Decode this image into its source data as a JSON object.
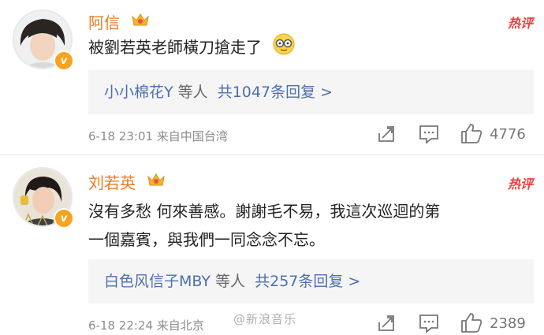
{
  "comments": [
    {
      "username": "阿信",
      "badge": "v",
      "hot_label": "热评",
      "text": "被劉若英老師橫刀搶走了",
      "reply": {
        "users": "小小棉花Y",
        "suffix": "等人",
        "count_text": "共1047条回复 >"
      },
      "meta": "6-18 23:01  来自中国台湾",
      "likes": "4776"
    },
    {
      "username": "刘若英",
      "badge": "v",
      "hot_label": "热评",
      "text_line1": "沒有多愁 何來善感。謝謝毛不易，我這次巡迴的第",
      "text_line2": "一個嘉賓，與我們一同念念不忘。",
      "reply": {
        "users": "白色风信子MBY",
        "suffix": "等人",
        "count_text": "共257条回复 >"
      },
      "meta": "6-18 22:24  来自北京",
      "likes": "2389"
    }
  ],
  "watermark": "@新浪音乐",
  "colors": {
    "username": "#e87c24",
    "link": "#4d6fae",
    "hot": "#f23c3c",
    "badge": "#f7a31f"
  },
  "icons": [
    "share-icon",
    "comment-icon",
    "like-icon",
    "crown-icon",
    "emoji-icon"
  ]
}
